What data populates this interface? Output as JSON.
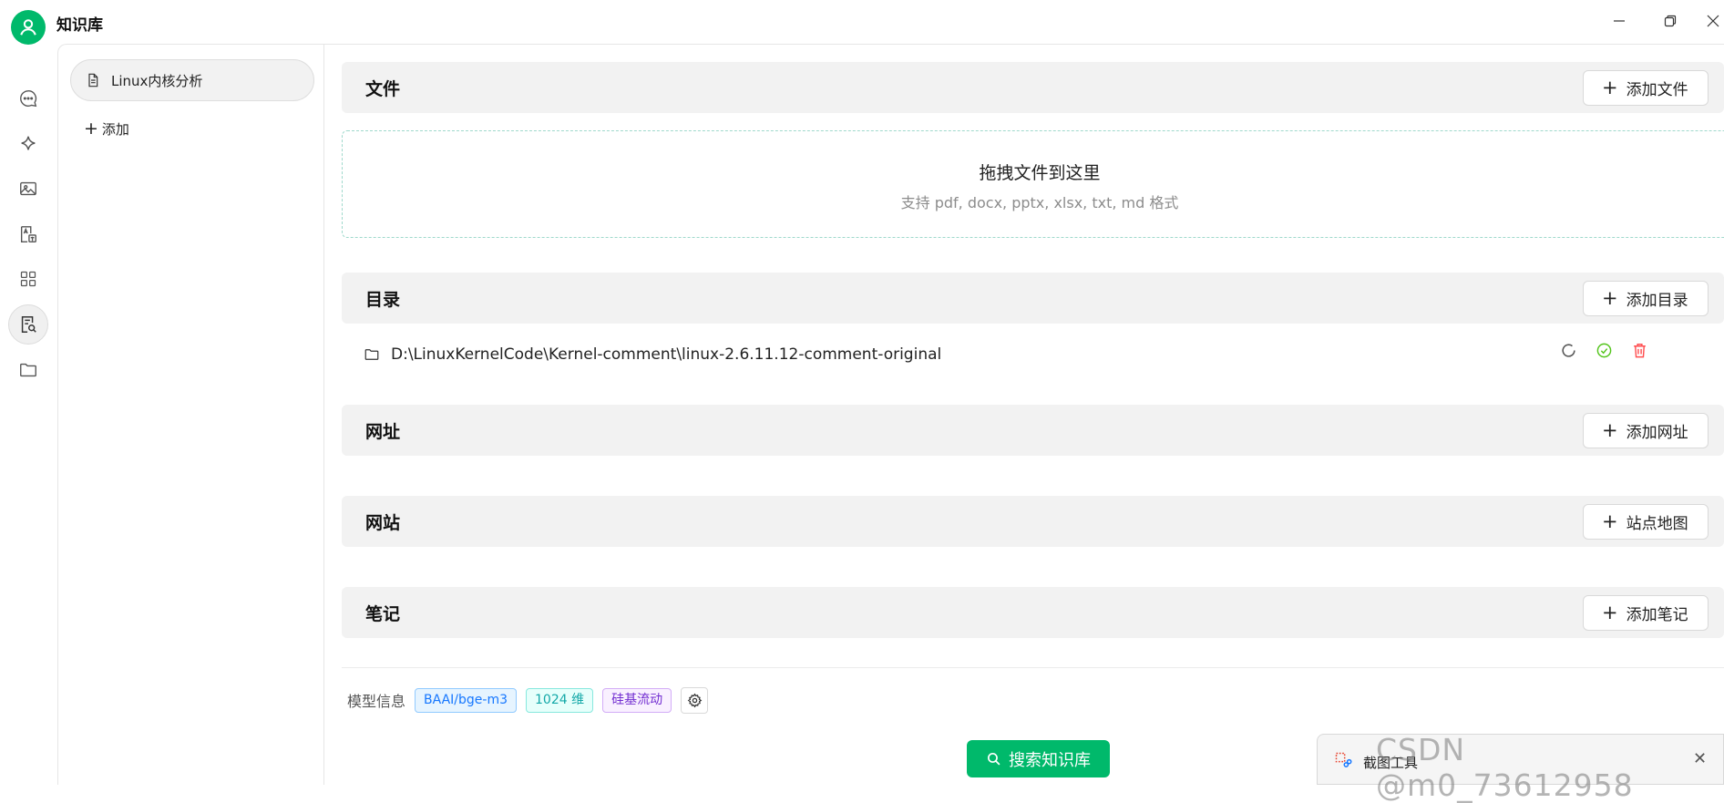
{
  "window": {
    "title": "知识库",
    "minimize_icon": "minimize-icon",
    "restore_icon": "restore-icon",
    "close_icon": "close-icon"
  },
  "rail": {
    "items": [
      {
        "icon": "chat-bubble-icon"
      },
      {
        "icon": "sparkle-icon"
      },
      {
        "icon": "image-icon"
      },
      {
        "icon": "translate-icon"
      },
      {
        "icon": "apps-grid-icon"
      },
      {
        "icon": "knowledge-search-icon",
        "active": true
      },
      {
        "icon": "folder-icon"
      }
    ]
  },
  "kb_list": {
    "items": [
      {
        "label": "Linux内核分析",
        "icon": "document-icon"
      }
    ],
    "add_label": "添加"
  },
  "sections": {
    "files": {
      "title": "文件",
      "button": "添加文件"
    },
    "dropzone": {
      "title": "拖拽文件到这里",
      "subtitle": "支持 pdf, docx, pptx, xlsx, txt, md 格式"
    },
    "directory": {
      "title": "目录",
      "button": "添加目录",
      "items": [
        {
          "path": "D:\\LinuxKernelCode\\Kernel-comment\\linux-2.6.11.12-comment-original"
        }
      ]
    },
    "urls": {
      "title": "网址",
      "button": "添加网址"
    },
    "websites": {
      "title": "网站",
      "button": "站点地图"
    },
    "notes": {
      "title": "笔记",
      "button": "添加笔记"
    }
  },
  "model_info": {
    "label": "模型信息",
    "tags": [
      "BAAI/bge-m3",
      "1024 维",
      "硅基流动"
    ]
  },
  "search_button": "搜索知识库",
  "overlay": {
    "tool_label": "截图工具",
    "watermark": "CSDN @m0_73612958"
  },
  "colors": {
    "accent": "#00b96b",
    "danger": "#ff4d4f",
    "success": "#52c41a"
  }
}
